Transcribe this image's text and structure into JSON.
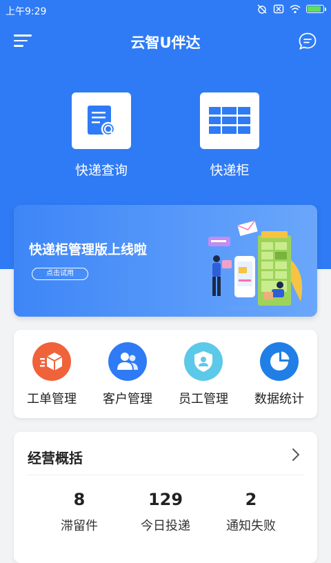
{
  "status_bar": {
    "time": "上午9:29"
  },
  "header": {
    "title": "云智U伴达"
  },
  "quick_actions": [
    {
      "label": "快递查询",
      "icon": "document-search-icon"
    },
    {
      "label": "快递柜",
      "icon": "locker-grid-icon"
    }
  ],
  "banner": {
    "title": "快递柜管理版上线啦",
    "button": "点击试用"
  },
  "functions": [
    {
      "label": "工单管理",
      "icon": "box-icon",
      "color": "#f0623a"
    },
    {
      "label": "客户管理",
      "icon": "users-icon",
      "color": "#2f7bf5"
    },
    {
      "label": "员工管理",
      "icon": "shield-user-icon",
      "color": "#5cc9e8"
    },
    {
      "label": "数据统计",
      "icon": "pie-chart-icon",
      "color": "#1f7fe6"
    }
  ],
  "overview": {
    "title": "经营概括",
    "stats": [
      {
        "value": "8",
        "label": "滞留件"
      },
      {
        "value": "129",
        "label": "今日投递"
      },
      {
        "value": "2",
        "label": "通知失败"
      }
    ]
  },
  "colors": {
    "primary": "#2f7bf5",
    "background": "#f2f3f5"
  }
}
